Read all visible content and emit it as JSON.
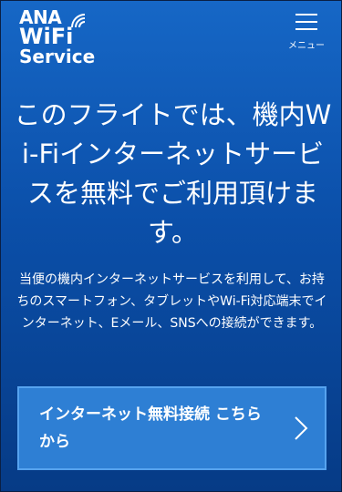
{
  "logo": {
    "line1": "ANA",
    "line2": "WiFi",
    "line3": "Service"
  },
  "menu": {
    "label": "メニュー"
  },
  "headline": "このフライトでは、機内Wi-Fiインターネットサービスを無料でご利用頂けます。",
  "description": "当便の機内インターネットサービスを利用して、お持ちのスマートフォン、タブレットやWi-Fi対応端末でインターネット、Eメール、SNSへの接続ができます。",
  "cta": {
    "label": "インターネット無料接続 こちらから"
  },
  "icons": {
    "menu": "hamburger-icon",
    "arrow": "chevron-right-icon",
    "wifi": "wifi-signal-icon"
  },
  "colors": {
    "background_top": "#1667c6",
    "background_bottom": "#063b86",
    "button": "#2e7fd4",
    "button_border": "#56a3ef"
  }
}
